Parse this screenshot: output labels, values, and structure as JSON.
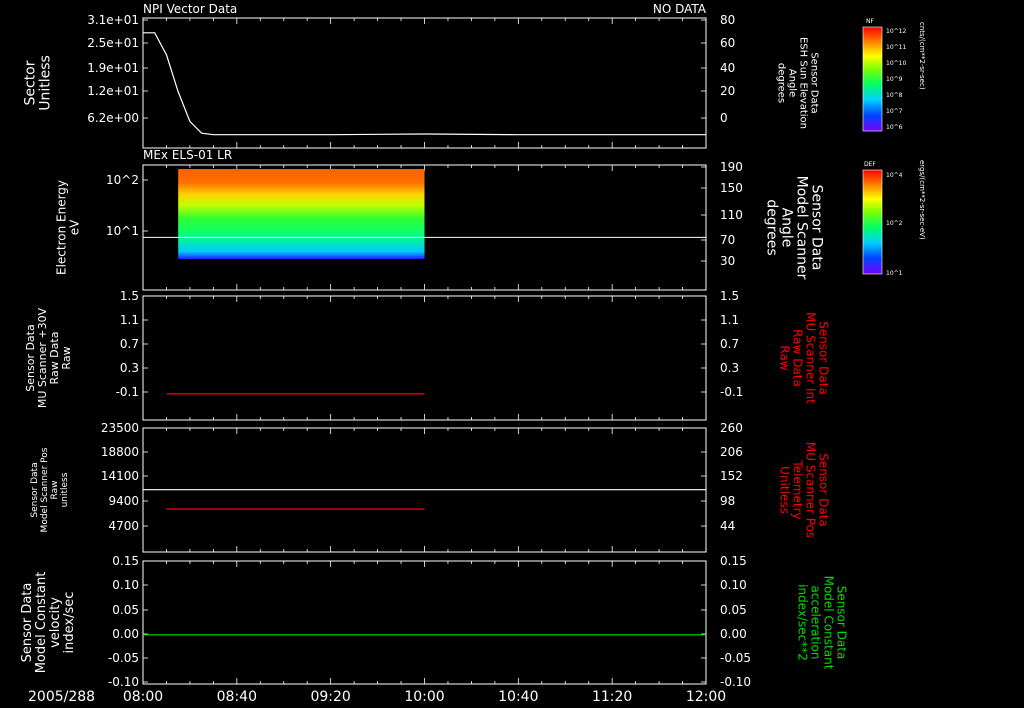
{
  "header": {
    "left": "NPI Vector Data",
    "right": "NO DATA"
  },
  "spectro_header": "MEx ELS-01 LR",
  "time_axis": {
    "date": "2005/288",
    "ticks": [
      "08:00",
      "08:40",
      "09:20",
      "10:00",
      "10:40",
      "11:20",
      "12:00"
    ]
  },
  "colors": {
    "white": "#ffffff",
    "red": "#ff0000",
    "green": "#00dd00"
  },
  "colorbars": [
    {
      "label": "NF",
      "units": "cnts/(cm**2-sr-sec)",
      "ticks": [
        "10^12",
        "10^11",
        "10^10",
        "10^9",
        "10^8",
        "10^7",
        "10^6"
      ]
    },
    {
      "label": "DEF",
      "units": "ergs/(cm**2-sr-sec-eV)",
      "ticks": [
        "10^4",
        "10^2",
        "10^1"
      ]
    }
  ],
  "chart_data": [
    {
      "type": "line",
      "panel": 1,
      "ylabel_left": [
        "Sector",
        "Unitless"
      ],
      "yticks_left": [
        "3.1e+01",
        "2.5e+01",
        "1.9e+01",
        "1.2e+01",
        "6.2e+00"
      ],
      "ylabel_right": [
        "Sensor Data",
        "ESH Sun Elevation",
        "Angle",
        "degrees"
      ],
      "yticks_right": [
        "80",
        "60",
        "40",
        "20",
        "0"
      ],
      "ylim_right": [
        -8,
        80
      ],
      "series": [
        {
          "color": "#ffffff",
          "x_min": [
            0,
            5,
            10,
            15,
            20,
            25,
            30,
            35,
            40,
            80,
            120,
            160,
            200,
            240
          ],
          "y": [
            70,
            70,
            55,
            30,
            10,
            2,
            1,
            1,
            1,
            1,
            1.5,
            1,
            1,
            1
          ]
        }
      ]
    },
    {
      "type": "heatmap",
      "panel": 2,
      "ylabel_left": [
        "Electron Energy",
        "eV"
      ],
      "yticks_left": [
        "10^2",
        "10^1"
      ],
      "ylabel_right": [
        "Sensor Data",
        "Model Scanner",
        "Angle",
        "degrees"
      ],
      "yticks_right": [
        "190",
        "150",
        "110",
        "70",
        "30"
      ],
      "ylim_right": [
        0,
        190
      ],
      "data_extent_min": [
        15,
        120
      ],
      "overlay_line": {
        "color": "#ffffff",
        "y": 80
      }
    },
    {
      "type": "line",
      "panel": 3,
      "ylabel_left": [
        "Sensor Data",
        "MU Scanner +30V",
        "Raw Data",
        "Raw"
      ],
      "yticks_left": [
        "1.5",
        "1.1",
        "0.7",
        "0.3",
        "-0.1"
      ],
      "ylabel_right": [
        "Sensor Data",
        "MU Scanner Int",
        "Raw Data",
        "Raw"
      ],
      "yticks_right": [
        "1.5",
        "1.1",
        "0.7",
        "0.3",
        "-0.1"
      ],
      "ylim": [
        -0.4,
        1.5
      ],
      "series": [
        {
          "color": "#ff0000",
          "x_min": [
            10,
            120
          ],
          "y": [
            0.0,
            0.0
          ]
        }
      ]
    },
    {
      "type": "line",
      "panel": 4,
      "ylabel_left": [
        "Sensor Data",
        "Model Scanner Pos",
        "Raw",
        "unitless"
      ],
      "yticks_left": [
        "23500",
        "18800",
        "14100",
        "9400",
        "4700"
      ],
      "ylabel_right": [
        "Sensor Data",
        "MU Scanner Pos",
        "Telemetry",
        "Unitless"
      ],
      "yticks_right": [
        "260",
        "206",
        "152",
        "98",
        "44"
      ],
      "ylim": [
        0,
        23500
      ],
      "series": [
        {
          "color": "#ffffff",
          "x_min": [
            0,
            240
          ],
          "y": [
            11800,
            11800
          ]
        },
        {
          "color": "#ff0000",
          "x_min": [
            10,
            120
          ],
          "y": [
            8150,
            8150
          ]
        }
      ]
    },
    {
      "type": "line",
      "panel": 5,
      "ylabel_left": [
        "Sensor Data",
        "Model Constant",
        "velocity",
        "index/sec"
      ],
      "yticks_left": [
        "0.15",
        "0.10",
        "0.05",
        "0.00",
        "-0.05",
        "-0.10"
      ],
      "ylabel_right": [
        "Sensor Data",
        "Model Constant",
        "acceleration",
        "index/sec**2"
      ],
      "yticks_right": [
        "0.15",
        "0.10",
        "0.05",
        "0.00",
        "-0.05",
        "-0.10"
      ],
      "ylim": [
        -0.1,
        0.15
      ],
      "series": [
        {
          "color": "#00dd00",
          "x_min": [
            0,
            240
          ],
          "y": [
            0.0,
            0.0
          ]
        }
      ]
    }
  ]
}
